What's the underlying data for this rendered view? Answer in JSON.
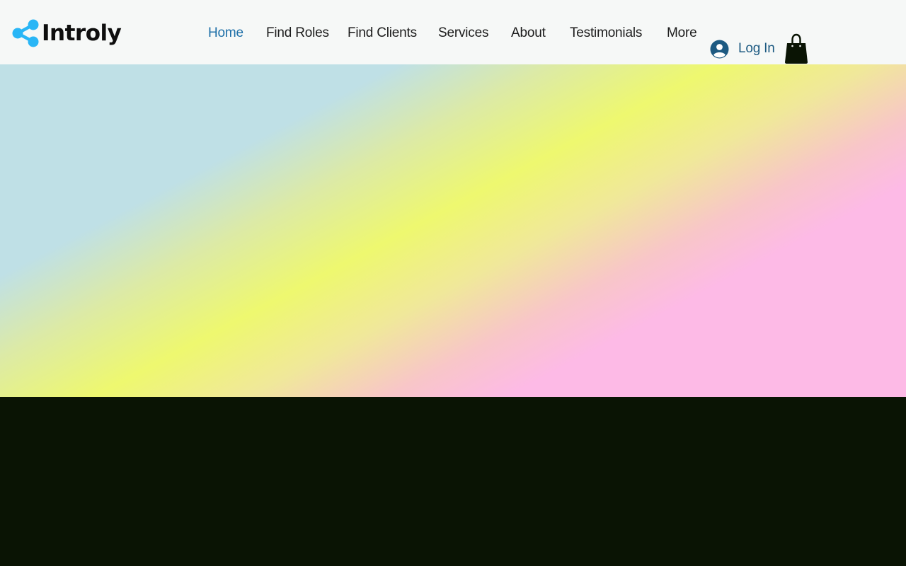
{
  "brand": {
    "name": "Introly",
    "icon": "share-icon",
    "icon_color": "#29b6f6"
  },
  "nav": {
    "items": [
      {
        "label": "Home",
        "active": true
      },
      {
        "label": "Find Roles",
        "active": false
      },
      {
        "label": "Find Clients",
        "active": false
      },
      {
        "label": "Services",
        "active": false
      },
      {
        "label": "About",
        "active": false
      },
      {
        "label": "Testimonials",
        "active": false
      },
      {
        "label": "More",
        "active": false
      }
    ],
    "active_color": "#1d6fa8"
  },
  "account": {
    "login_label": "Log In",
    "icon": "user-avatar-icon",
    "color": "#1d5a82"
  },
  "cart": {
    "icon": "shopping-bag-icon"
  },
  "colors": {
    "header_bg": "#f6f8f7",
    "hero_gradient": [
      "#bfe0e6",
      "#eef86f",
      "#fdbae6"
    ],
    "footer_bg": "#0a1404"
  }
}
